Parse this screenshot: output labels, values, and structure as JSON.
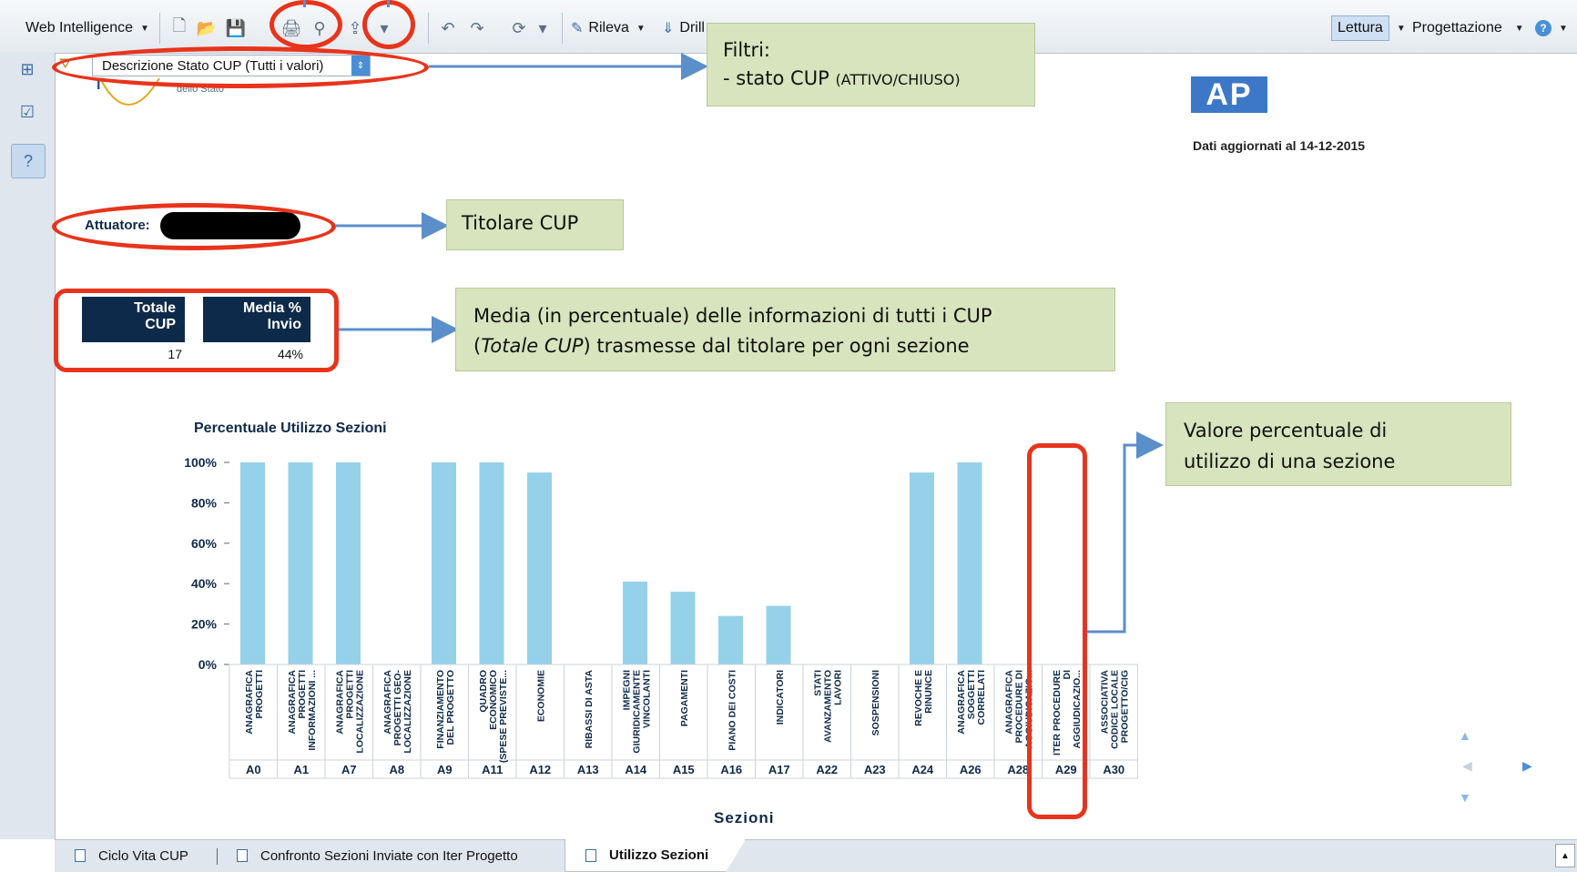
{
  "toolbar": {
    "app_menu": "Web Intelligence",
    "rileva": "Rileva",
    "drill": "Drill",
    "lettura": "Lettura",
    "progettazione": "Progettazione",
    "help_icon": "help-icon"
  },
  "filter": {
    "selected": "Descrizione Stato CUP (Tutti i valori)"
  },
  "report": {
    "logo_caption": "dello Stato",
    "logo_right": "AP",
    "updated": "Dati aggiornati al 14-12-2015",
    "attuatore_label": "Attuatore:",
    "kpi": {
      "totale_head": [
        "Totale",
        "CUP"
      ],
      "media_head": [
        "Media %",
        "Invio"
      ],
      "totale_value": "17",
      "media_value": "44%"
    }
  },
  "notes": {
    "filtri_title": "Filtri:",
    "filtri_line": "- stato CUP ",
    "filtri_small": "(ATTIVO/CHIUSO)",
    "titolare": "Titolare CUP",
    "media_l1": "Media (in percentuale) delle informazioni di tutti i CUP",
    "media_l2a": "(",
    "media_l2i": "Totale CUP",
    "media_l2b": ") trasmesse dal titolare per ogni sezione",
    "valore_l1": "Valore percentuale di",
    "valore_l2": "utilizzo di una sezione"
  },
  "chart_data": {
    "type": "bar",
    "title": "Percentuale Utilizzo Sezioni",
    "xlabel": "Sezioni",
    "ylabel": "",
    "ylim": [
      0,
      100
    ],
    "yticks": [
      "0%",
      "20%",
      "40%",
      "60%",
      "80%",
      "100%"
    ],
    "grid": false,
    "categories": [
      "A0",
      "A1",
      "A7",
      "A8",
      "A9",
      "A11",
      "A12",
      "A13",
      "A14",
      "A15",
      "A16",
      "A17",
      "A22",
      "A23",
      "A24",
      "A26",
      "A28",
      "A29",
      "A30"
    ],
    "category_descriptions": [
      [
        "ANAGRAFICA",
        "PROGETTI"
      ],
      [
        "ANAGRAFICA",
        "PROGETTI",
        "INFORMAZIONI ..."
      ],
      [
        "ANAGRAFICA",
        "PROGETTI",
        "LOCALIZZAZIONE"
      ],
      [
        "ANAGRAFICA",
        "PROGETTI GEO-",
        "LOCALIZZAZIONE"
      ],
      [
        "FINANZIAMENTO",
        "DEL PROGETTO"
      ],
      [
        "QUADRO",
        "ECONOMICO",
        "(SPESE PREVISTE..."
      ],
      [
        "ECONOMIE"
      ],
      [
        "RIBASSI DI ASTA"
      ],
      [
        "IMPEGNI",
        "GIURIDICAMENTE",
        "VINCOLANTI"
      ],
      [
        "PAGAMENTI"
      ],
      [
        "PIANO DEI COSTI"
      ],
      [
        "INDICATORI"
      ],
      [
        "STATI",
        "AVANZAMENTO",
        "LAVORI"
      ],
      [
        "SOSPENSIONI"
      ],
      [
        "REVOCHE E",
        "RINUNCE"
      ],
      [
        "ANAGRAFICA",
        "SOGGETTI",
        "CORRELATI"
      ],
      [
        "ANAGRAFICA",
        "PROCEDURE DI",
        "AGGIUDICAZIO..."
      ],
      [
        "ITER PROCEDURE",
        "DI",
        "AGGIUDICAZIO..."
      ],
      [
        "ASSOCIATIVA",
        "CODICE LOCALE",
        "PROGETTO/CIG"
      ]
    ],
    "values": [
      100,
      100,
      100,
      0,
      100,
      100,
      95,
      0,
      41,
      36,
      24,
      29,
      0,
      0,
      95,
      100,
      0,
      0,
      0
    ],
    "bar_color": "#96d1ea"
  },
  "tabs": [
    {
      "label": "Ciclo Vita CUP"
    },
    {
      "label": "Confronto Sezioni Inviate con Iter Progetto"
    },
    {
      "label": "Utilizzo Sezioni"
    }
  ],
  "colors": {
    "accent_red": "#e8341c",
    "note_bg": "#d7e4bd",
    "kpi_header": "#0e2a4a",
    "arrow": "#5b8fc9"
  }
}
